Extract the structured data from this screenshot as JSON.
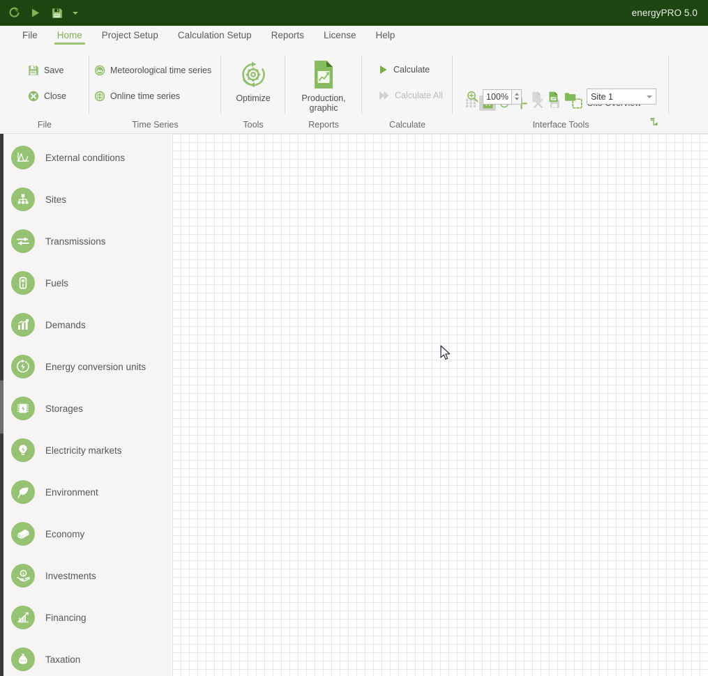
{
  "titlebar": {
    "app_title": "energyPRO 5.0",
    "quick_access": [
      {
        "name": "recalculate-icon",
        "label": "Recalculate"
      },
      {
        "name": "run-icon",
        "label": "Run"
      },
      {
        "name": "save-icon",
        "label": "Save"
      },
      {
        "name": "customize-caret-icon",
        "label": "Customize Quick Access Toolbar"
      }
    ],
    "colors": {
      "bar_bg": "#1d4512",
      "title_text": "#e9eee4"
    }
  },
  "menubar": {
    "items": [
      {
        "label": "File",
        "active": false
      },
      {
        "label": "Home",
        "active": true
      },
      {
        "label": "Project Setup",
        "active": false
      },
      {
        "label": "Calculation Setup",
        "active": false
      },
      {
        "label": "Reports",
        "active": false
      },
      {
        "label": "License",
        "active": false
      },
      {
        "label": "Help",
        "active": false
      }
    ],
    "active_color": "#82b04e"
  },
  "ribbon": {
    "groups": {
      "file": {
        "label": "File",
        "save_label": "Save",
        "close_label": "Close"
      },
      "time_series": {
        "label": "Time Series",
        "meteorological_label": "Meteorological time series",
        "online_label": "Online time series"
      },
      "tools": {
        "label": "Tools",
        "optimize_label": "Optimize"
      },
      "reports": {
        "label": "Reports",
        "production_graphic_label": "Production,\ngraphic",
        "production_graphic_line1": "Production,",
        "production_graphic_line2": "graphic"
      },
      "calculate": {
        "label": "Calculate",
        "calculate_label": "Calculate",
        "calculate_all_label": "Calculate All",
        "calculate_all_enabled": false
      },
      "interface_tools": {
        "label": "Interface Tools",
        "top_icons": [
          {
            "name": "grid-view-icon",
            "enabled": false,
            "selected": false
          },
          {
            "name": "align-icon",
            "enabled": true,
            "selected": true
          },
          {
            "name": "refresh-icon",
            "enabled": true,
            "selected": false
          },
          {
            "name": "add-icon",
            "enabled": true,
            "selected": false
          },
          {
            "name": "delete-icon",
            "enabled": false,
            "selected": false
          },
          {
            "name": "save-layout-icon",
            "enabled": false,
            "selected": false
          }
        ],
        "site_overview_label": "Site Overview",
        "zoom_value": "100%",
        "zoom_icon": "zoom-in-icon",
        "bottom_icons": [
          {
            "name": "new-page-icon",
            "enabled": false
          },
          {
            "name": "copy-page-icon",
            "enabled": true
          },
          {
            "name": "open-folder-icon",
            "enabled": true
          }
        ],
        "site_select_value": "Site 1",
        "dialog_launcher": "dialog-launcher-icon"
      }
    }
  },
  "sidebar": {
    "items": [
      {
        "label": "External conditions",
        "icon": "external-conditions-icon"
      },
      {
        "label": "Sites",
        "icon": "sites-icon"
      },
      {
        "label": "Transmissions",
        "icon": "transmissions-icon"
      },
      {
        "label": "Fuels",
        "icon": "fuels-icon"
      },
      {
        "label": "Demands",
        "icon": "demands-icon"
      },
      {
        "label": "Energy conversion units",
        "icon": "energy-conversion-units-icon"
      },
      {
        "label": "Storages",
        "icon": "storages-icon"
      },
      {
        "label": "Electricity markets",
        "icon": "electricity-markets-icon"
      },
      {
        "label": "Environment",
        "icon": "environment-icon"
      },
      {
        "label": "Economy",
        "icon": "economy-icon"
      },
      {
        "label": "Investments",
        "icon": "investments-icon"
      },
      {
        "label": "Financing",
        "icon": "financing-icon"
      },
      {
        "label": "Taxation",
        "icon": "taxation-icon"
      }
    ],
    "icon_color": "#95c273",
    "background": "#f6f5f3"
  },
  "canvas": {
    "grid_spacing_px": 12,
    "grid_color": "#e6e6e6",
    "background": "#ffffff"
  }
}
